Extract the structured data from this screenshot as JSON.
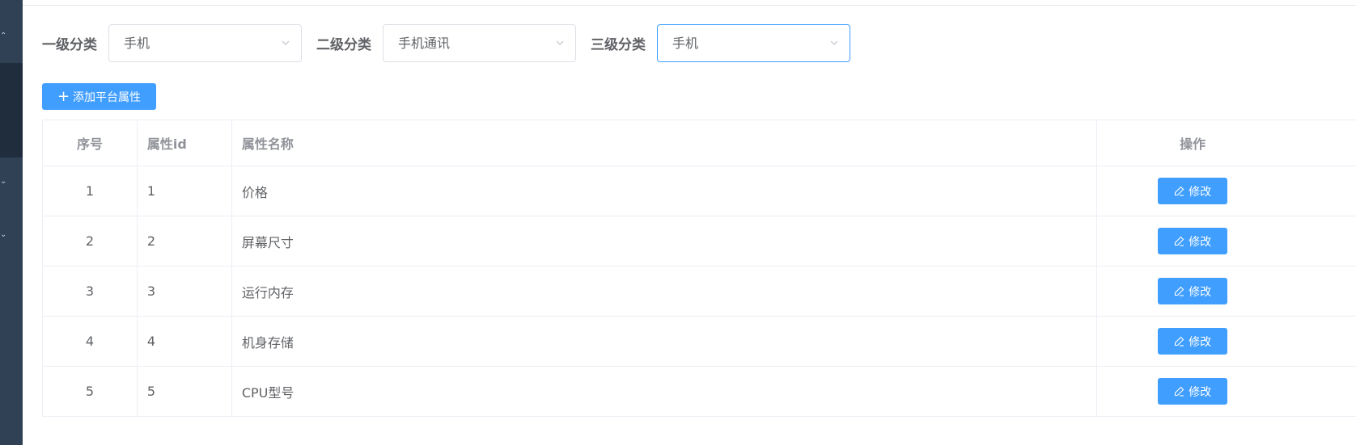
{
  "filters": [
    {
      "label": "一级分类",
      "value": "手机"
    },
    {
      "label": "二级分类",
      "value": "手机通讯"
    },
    {
      "label": "三级分类",
      "value": "手机"
    }
  ],
  "toolbar": {
    "add_label": "添加平台属性",
    "add_icon": "plus-icon"
  },
  "table": {
    "headers": {
      "index": "序号",
      "id": "属性id",
      "name": "属性名称",
      "action": "操作"
    },
    "rows": [
      {
        "index": "1",
        "id": "1",
        "name": "价格",
        "action": "修改"
      },
      {
        "index": "2",
        "id": "2",
        "name": "屏幕尺寸",
        "action": "修改"
      },
      {
        "index": "3",
        "id": "3",
        "name": "运行内存",
        "action": "修改"
      },
      {
        "index": "4",
        "id": "4",
        "name": "机身存储",
        "action": "修改"
      },
      {
        "index": "5",
        "id": "5",
        "name": "CPU型号",
        "action": "修改"
      }
    ]
  },
  "colors": {
    "primary": "#409eff",
    "sidebar": "#304156",
    "sidebar_active": "#1f2d3d",
    "border": "#ebeef5"
  }
}
